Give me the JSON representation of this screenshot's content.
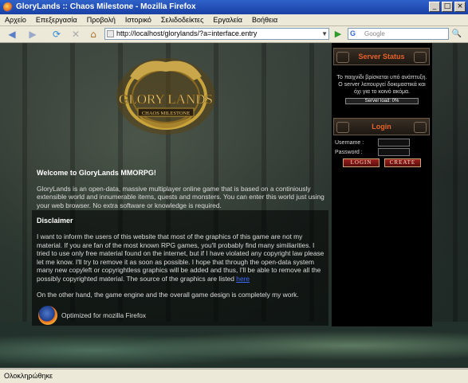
{
  "window": {
    "title": "GloryLands :: Chaos Milestone - Mozilla Firefox",
    "btn_min": "_",
    "btn_max": "□",
    "btn_close": "×"
  },
  "menu": {
    "items": [
      "Αρχείο",
      "Επεξεργασία",
      "Προβολή",
      "Ιστορικό",
      "Σελιδοδείκτες",
      "Εργαλεία",
      "Βοήθεια"
    ]
  },
  "nav": {
    "back_icon": "◀",
    "forward_icon": "▶",
    "reload_icon": "⟳",
    "stop_icon": "✕",
    "home_icon": "⌂",
    "url": "http://localhost/glorylands/?a=interface.entry",
    "go_icon": "▶",
    "search_placeholder": "Google",
    "search_engine_icon": "G",
    "search_button_icon": "🔍"
  },
  "logo": {
    "text_line1": "GLORY LANDS",
    "text_line2": "CHAOS MILESTONE"
  },
  "main": {
    "welcome_title": "Welcome to GloryLands MMORPG!",
    "intro": "GloryLands is an open-data, massive multiplayer online game that is based on a continiously extensible world and innumerable items, quests and monsters. You can enter this world just using your web browser. No extra software or knowledge is required.",
    "disclaimer_title": "Disclaimer",
    "disclaimer_text": "I want to inform the users of this website that most of the graphics of this game are not my material. If you are fan of the most known RPG games, you'll probably find many similiarities. I tried to use only free material found on the internet, but if I have violated any copyright law please let me know. I'll try to remove it as soon as possible. I hope that through the open-data system many new copyleft or copyrightless graphics will be added and thus, I'll be able to remove all the possibly copyrighted material. The source of the graphics are listed",
    "here_link": "here",
    "engine_text": "On the other hand, the game engine and the overall game design is completely my work.",
    "firefox_text": "Optimized for mozilla Firefox"
  },
  "server_status": {
    "heading": "Server Status",
    "message": "Το παιχνίδι βρίσκεται υπό ανάπτυξη. Ο server λειτουργεί δοκιμαστικά και όχι για το κοινό ακόμα.",
    "load_label": "Server load: 0%",
    "load_fraction": 0.0
  },
  "login": {
    "heading": "Login",
    "username_label": "Username :",
    "password_label": "Password :",
    "login_button": "LOGIN",
    "create_button": "CREATE"
  },
  "statusbar": {
    "text": "Ολοκληρώθηκε"
  }
}
